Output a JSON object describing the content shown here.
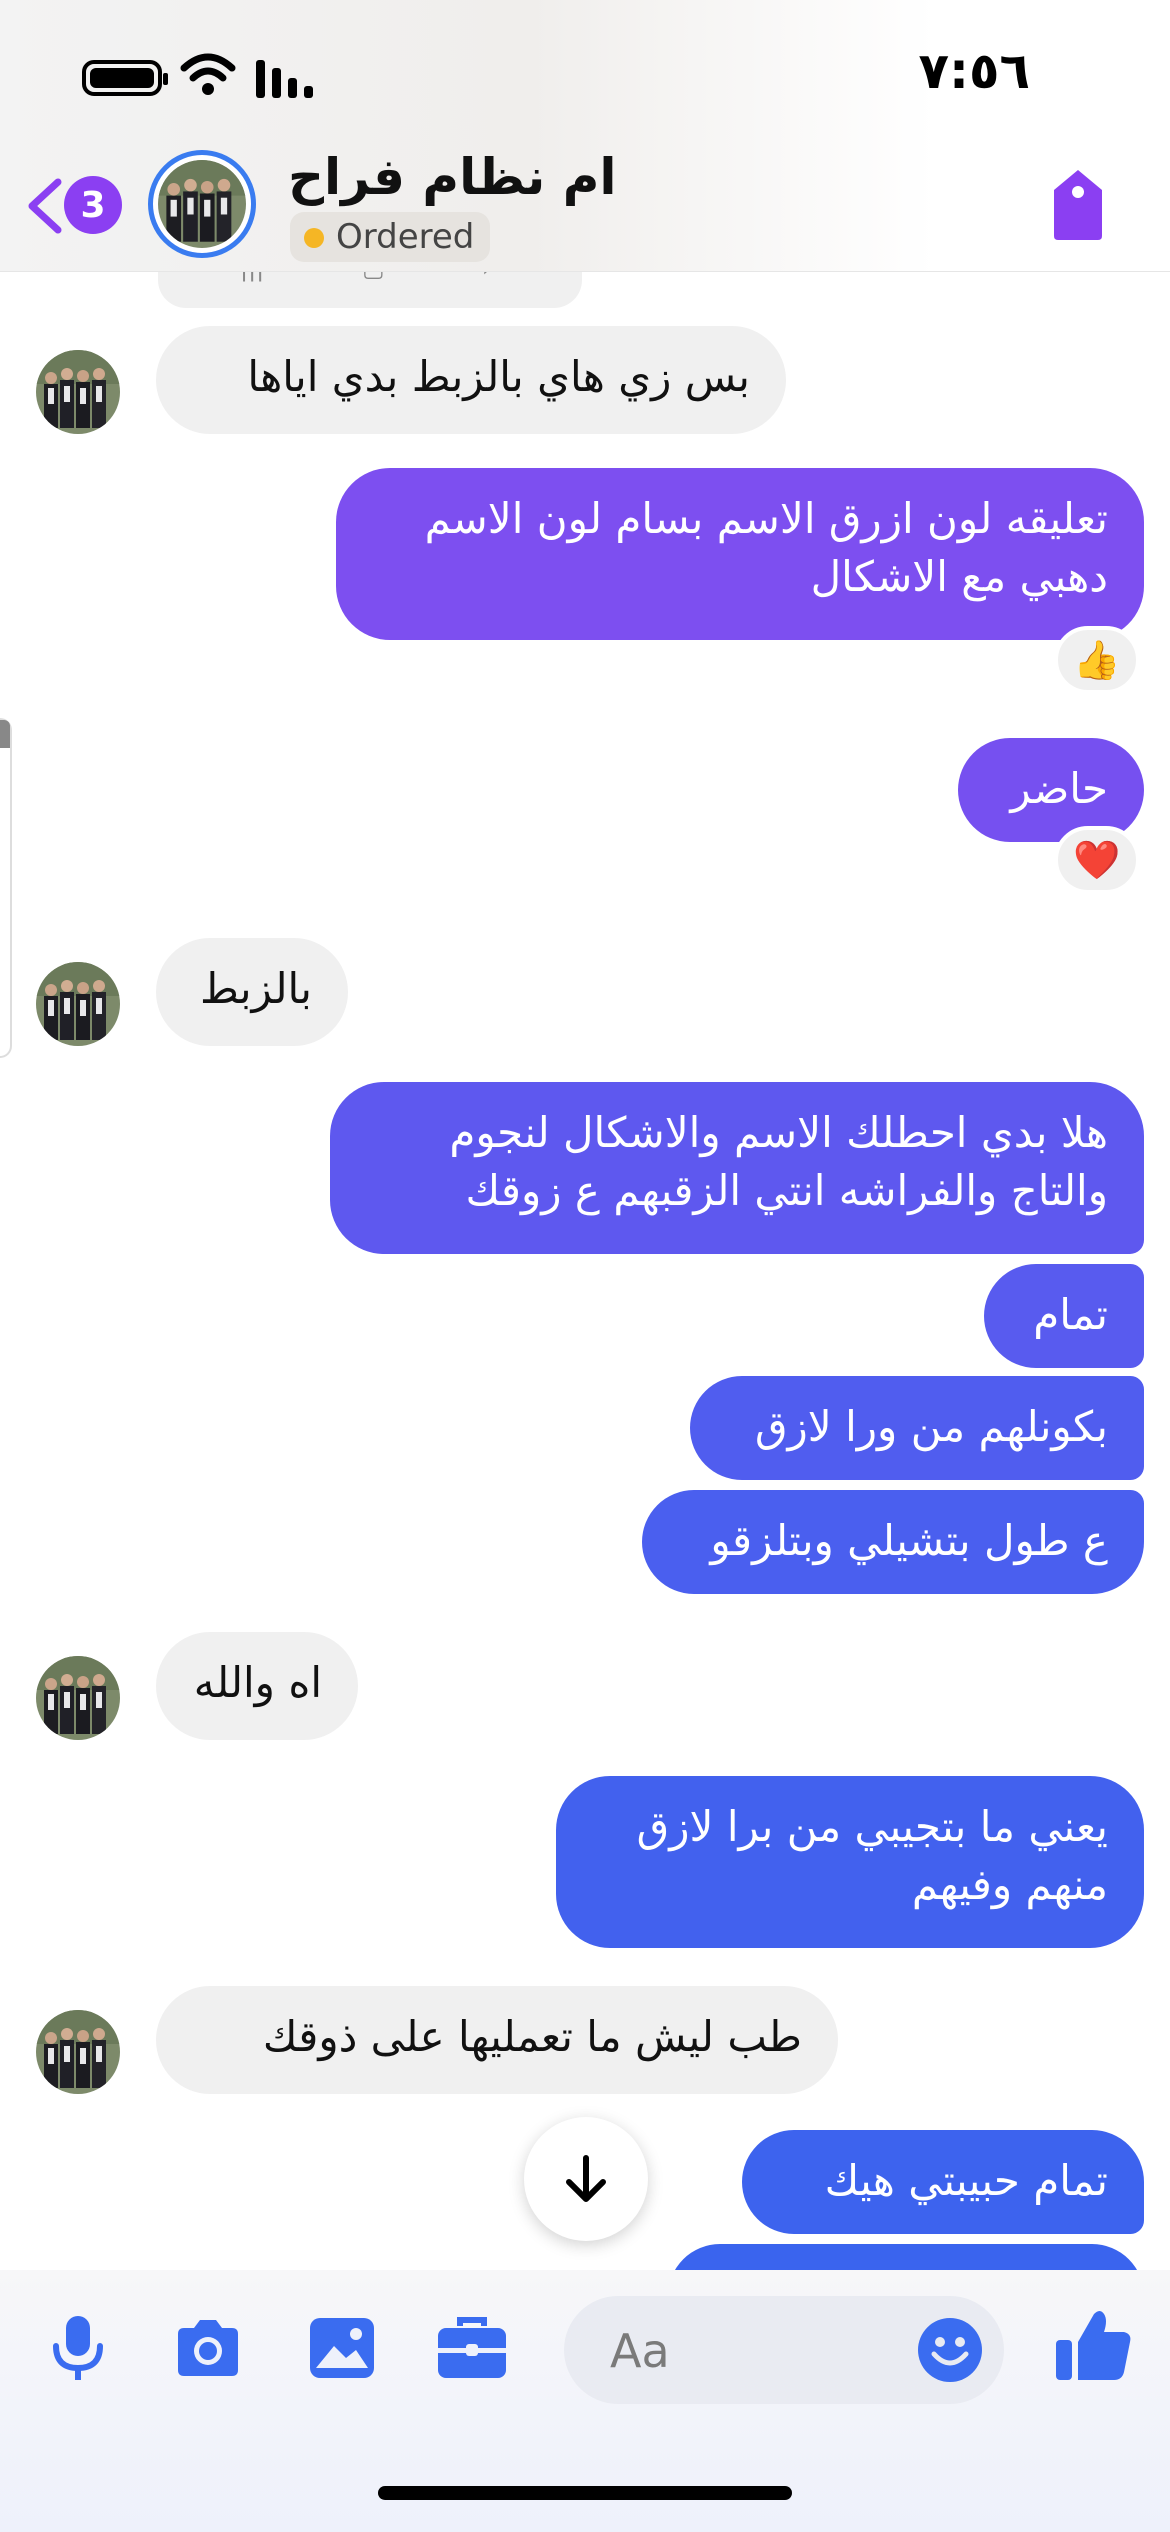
{
  "status_bar": {
    "time": "٧:٥٦"
  },
  "header": {
    "unread_count": "3",
    "contact_name": "ام نظام فراح",
    "order_status": "Ordered"
  },
  "messages": [
    {
      "direction": "in",
      "text": "بس زي هاي بالزبط بدي اياها"
    },
    {
      "direction": "out",
      "lines": [
        "تعليقه لون ازرق الاسم بسام لون الاسم",
        "دهبي مع الاشكال"
      ],
      "reaction": "👍"
    },
    {
      "direction": "out",
      "text": "حاضر",
      "reaction": "❤️"
    },
    {
      "direction": "in",
      "text": "بالزبط"
    },
    {
      "direction": "out",
      "lines": [
        "هلا بدي احطلك الاسم والاشكال لنجوم",
        "والتاج والفراشه انتي الزقبهم ع زوقك"
      ]
    },
    {
      "direction": "out",
      "text": "تمام"
    },
    {
      "direction": "out",
      "text": "بكونلهم من ورا لازق"
    },
    {
      "direction": "out",
      "text": "ع طول بتشيلي وبتلزقو"
    },
    {
      "direction": "in",
      "text": "اه والله"
    },
    {
      "direction": "out",
      "lines": [
        "يعني ما بتجيبي من برا لازق",
        "منهم وفيهم"
      ]
    },
    {
      "direction": "in",
      "text": "طب ليش ما تعمليها على ذوقك"
    },
    {
      "direction": "out",
      "text": "تمام حبيبتي هيك"
    }
  ],
  "composer": {
    "placeholder": "Aa",
    "icons": [
      "microphone-icon",
      "camera-icon",
      "image-icon",
      "briefcase-icon",
      "emoji-icon",
      "thumbs-up-icon"
    ]
  },
  "colors": {
    "accent_purple": "#8b3ff2",
    "bubble_purple": "#7b4ff0",
    "bubble_blue": "#3d63ee",
    "incoming_bubble": "#f0f0f0",
    "link_blue": "#3a7cf0"
  }
}
